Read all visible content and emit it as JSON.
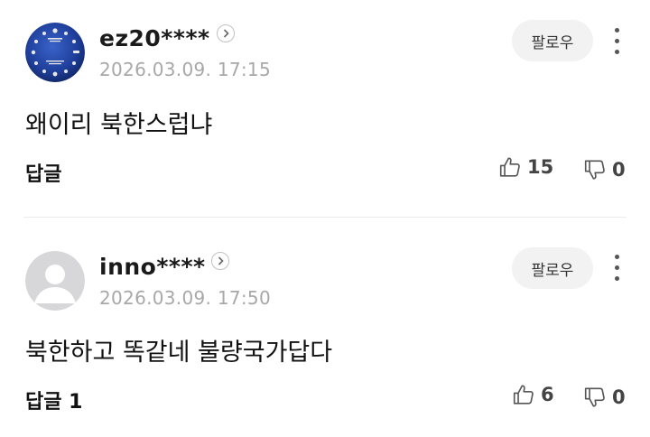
{
  "comments": [
    {
      "username": "ez20****",
      "date": "2026.03.09. 17:15",
      "follow_label": "팔로우",
      "text": "왜이리 북한스럽냐",
      "reply_label": "답글",
      "likes": "15",
      "dislikes": "0",
      "avatar_icon": "watch-dial-avatar-icon"
    },
    {
      "username": "inno****",
      "date": "2026.03.09. 17:50",
      "follow_label": "팔로우",
      "text": "북한하고 똑같네 불량국가답다",
      "reply_label": "답글 1",
      "likes": "6",
      "dislikes": "0",
      "avatar_icon": "default-user-avatar-icon"
    }
  ],
  "colors": {
    "watch_dial_blue": "#1f3f9c",
    "follow_bg": "#f2f2f2",
    "date_gray": "#a8a8a8"
  }
}
